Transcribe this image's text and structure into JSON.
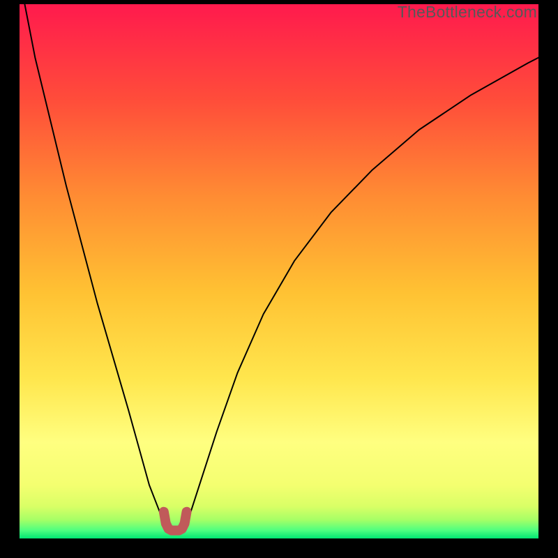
{
  "watermark": "TheBottleneck.com",
  "chart_data": {
    "type": "line",
    "title": "",
    "xlabel": "",
    "ylabel": "",
    "xlim": [
      0,
      100
    ],
    "ylim": [
      0,
      100
    ],
    "grid": false,
    "background_gradient": {
      "top": "#ff1a4d",
      "upper_mid": "#ff7a33",
      "mid": "#ffd633",
      "lower_mid": "#ffff80",
      "near_bottom": "#eaff6a",
      "bottom": "#00e673"
    },
    "series": [
      {
        "name": "bottleneck-curve",
        "color": "#000000",
        "x": [
          1,
          3,
          6,
          9,
          12,
          15,
          18,
          21,
          23,
          25,
          27,
          28.5,
          30,
          31,
          31.8,
          33,
          35,
          38,
          42,
          47,
          53,
          60,
          68,
          77,
          87,
          98,
          100
        ],
        "y": [
          100,
          90,
          78,
          66,
          55,
          44,
          34,
          24,
          17,
          10,
          5,
          2.2,
          1.5,
          1.5,
          2.2,
          5,
          11,
          20,
          31,
          42,
          52,
          61,
          69,
          76.5,
          83,
          89,
          90
        ]
      },
      {
        "name": "optimal-range-marker",
        "color": "#c05a5a",
        "stroke_width": 14,
        "x": [
          27.8,
          28.2,
          28.7,
          29.3,
          30.0,
          30.7,
          31.3,
          31.8,
          32.2
        ],
        "y": [
          5.0,
          2.8,
          1.8,
          1.5,
          1.5,
          1.5,
          1.8,
          2.8,
          5.0
        ]
      }
    ],
    "annotations": []
  }
}
